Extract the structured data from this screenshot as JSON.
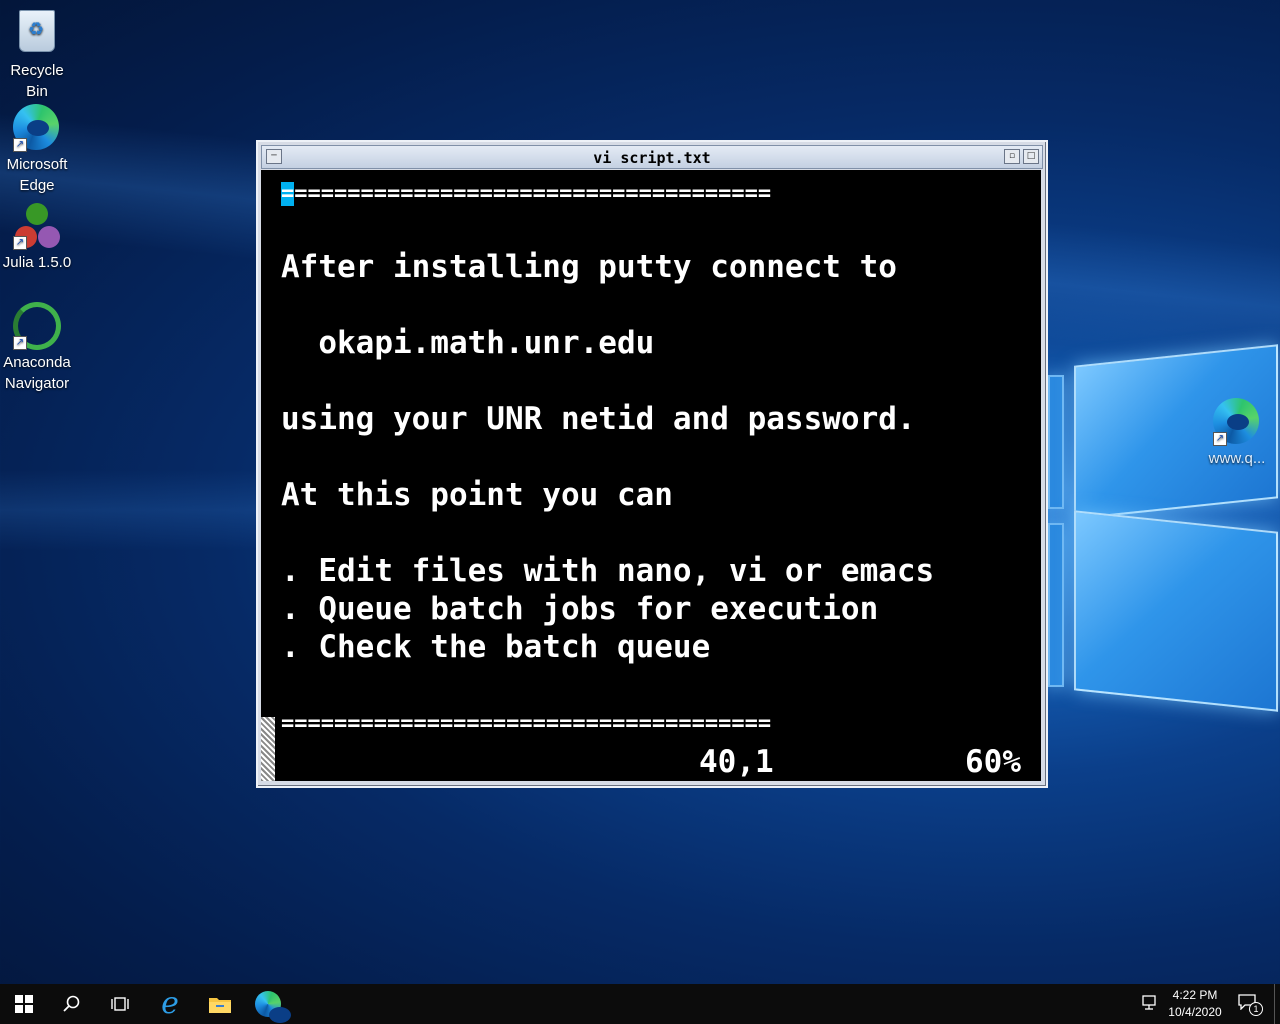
{
  "desktop": {
    "icons": [
      {
        "label_line1": "Recycle",
        "label_line2": "Bin",
        "icon": "recycle-bin-icon"
      },
      {
        "label_line1": "Microsoft",
        "label_line2": "Edge",
        "icon": "edge-icon"
      },
      {
        "label_line1": "Julia 1.5.0",
        "label_line2": "",
        "icon": "julia-icon"
      },
      {
        "label_line1": "Anaconda",
        "label_line2": "Navigator",
        "icon": "anaconda-icon"
      },
      {
        "label_line1": "www.q...",
        "label_line2": "",
        "icon": "edge-shortcut-icon"
      }
    ]
  },
  "window": {
    "title": "vi script.txt"
  },
  "terminal": {
    "cursor_char": "=",
    "top_rule": "====================================",
    "lines": [
      "After installing putty connect to",
      "  okapi.math.unr.edu",
      "using your UNR netid and password.",
      "At this point you can",
      ". Edit files with nano, vi or emacs",
      ". Queue batch jobs for execution",
      ". Check the batch queue"
    ],
    "bottom_rule": "=====================================",
    "status_position": "40,1",
    "status_percent": "60%"
  },
  "taskbar": {
    "icons": [
      "windows-start-icon",
      "search-icon",
      "task-view-icon",
      "internet-explorer-icon",
      "file-explorer-icon",
      "edge-icon"
    ],
    "time": "4:22 PM",
    "date": "10/4/2020",
    "notification_count": "1"
  },
  "colors": {
    "cursor": "#00b0f0",
    "terminal_bg": "#000000",
    "terminal_fg": "#ffffff",
    "taskbar_bg": "#0c0c0c"
  }
}
